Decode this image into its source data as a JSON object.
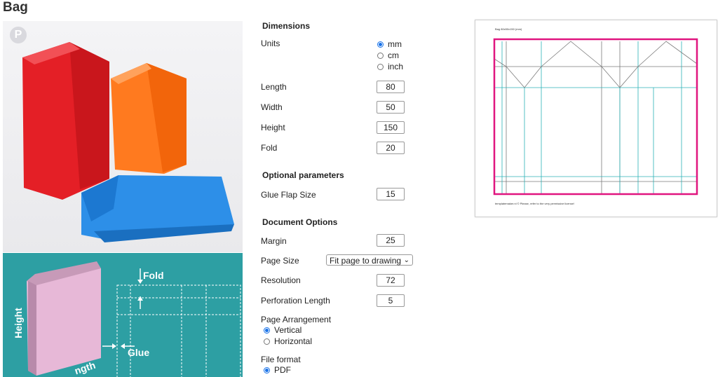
{
  "page": {
    "title": "Bag"
  },
  "photo": {
    "pin_glyph": "P"
  },
  "diagram": {
    "fold_label": "Fold",
    "height_label": "Height",
    "glue_label": "Glue",
    "length_label": "ngth"
  },
  "form": {
    "dimensions_heading": "Dimensions",
    "units_label": "Units",
    "units_options": [
      "mm",
      "cm",
      "inch"
    ],
    "units_selected": "mm",
    "length_label": "Length",
    "length_value": "80",
    "width_label": "Width",
    "width_value": "50",
    "height_label": "Height",
    "height_value": "150",
    "fold_label": "Fold",
    "fold_value": "20",
    "optional_heading": "Optional parameters",
    "glue_label": "Glue Flap Size",
    "glue_value": "15",
    "document_heading": "Document Options",
    "margin_label": "Margin",
    "margin_value": "25",
    "page_size_label": "Page Size",
    "page_size_value": "Fit page to drawing",
    "resolution_label": "Resolution",
    "resolution_value": "72",
    "perforation_label": "Perforation Length",
    "perforation_value": "5",
    "arrangement_label": "Page Arrangement",
    "arrangement_options": [
      "Vertical",
      "Horizontal"
    ],
    "arrangement_selected": "Vertical",
    "file_format_label": "File format",
    "file_format_options": [
      "PDF"
    ],
    "file_format_selected": "PDF"
  },
  "preview": {
    "caption": "Bag 80x50x150 (mm)",
    "footer": "templatemaker.nl © Please, refer to the very permissive license!",
    "border_color": "#e0157f",
    "crease_color": "#2bb3b8"
  }
}
